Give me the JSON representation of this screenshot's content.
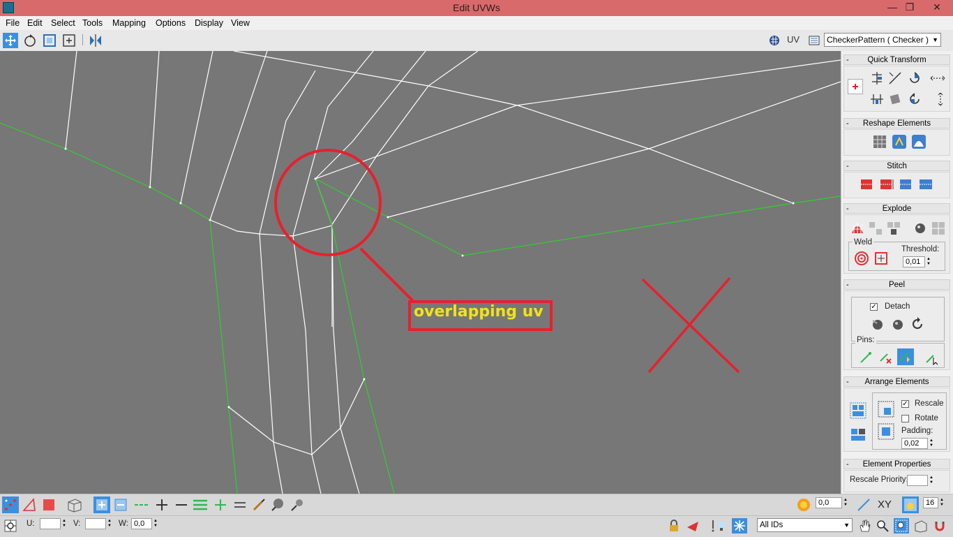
{
  "window": {
    "title": "Edit UVWs",
    "controls": [
      "—",
      "❐",
      "✕"
    ]
  },
  "menu": [
    "File",
    "Edit",
    "Select",
    "Tools",
    "Mapping",
    "Options",
    "Display",
    "View"
  ],
  "toolbar": {
    "tools": [
      "move-icon",
      "rotate-icon",
      "scale-icon",
      "freeform-icon",
      "mirror-icon"
    ],
    "uv_label": "UV",
    "texture_select": "CheckerPattern  ( Checker )"
  },
  "annotation": {
    "text": "overlapping uv",
    "color": "#e8202c",
    "text_color": "#f2e21a"
  },
  "panel": {
    "quick_transform": {
      "title": "Quick Transform"
    },
    "reshape": {
      "title": "Reshape Elements"
    },
    "stitch": {
      "title": "Stitch"
    },
    "explode": {
      "title": "Explode",
      "weld_label": "Weld",
      "threshold_label": "Threshold:",
      "threshold_value": "0,01"
    },
    "peel": {
      "title": "Peel",
      "detach_label": "Detach",
      "detach_checked": true,
      "pins_label": "Pins:"
    },
    "arrange": {
      "title": "Arrange Elements",
      "rescale_label": "Rescale",
      "rescale_checked": true,
      "rotate_label": "Rotate",
      "rotate_checked": false,
      "padding_label": "Padding:",
      "padding_value": "0,02"
    },
    "element_props": {
      "title": "Element Properties",
      "rescale_priority_label": "Rescale Priority:",
      "rescale_priority_value": ""
    },
    "collapse_symbol": "-"
  },
  "bottom": {
    "angle_value": "0,0",
    "xy_label": "XY",
    "grid_value": "16",
    "u_label": "U:",
    "v_label": "V:",
    "w_label": "W:",
    "w_value": "0,0",
    "ids_select": "All IDs"
  },
  "colors": {
    "viewport_bg": "#777777",
    "wire_white": "#ffffff",
    "seam_green": "#2fcf2f",
    "titlebar": "#d96a6c",
    "selection_blue": "#3b8fe0"
  }
}
